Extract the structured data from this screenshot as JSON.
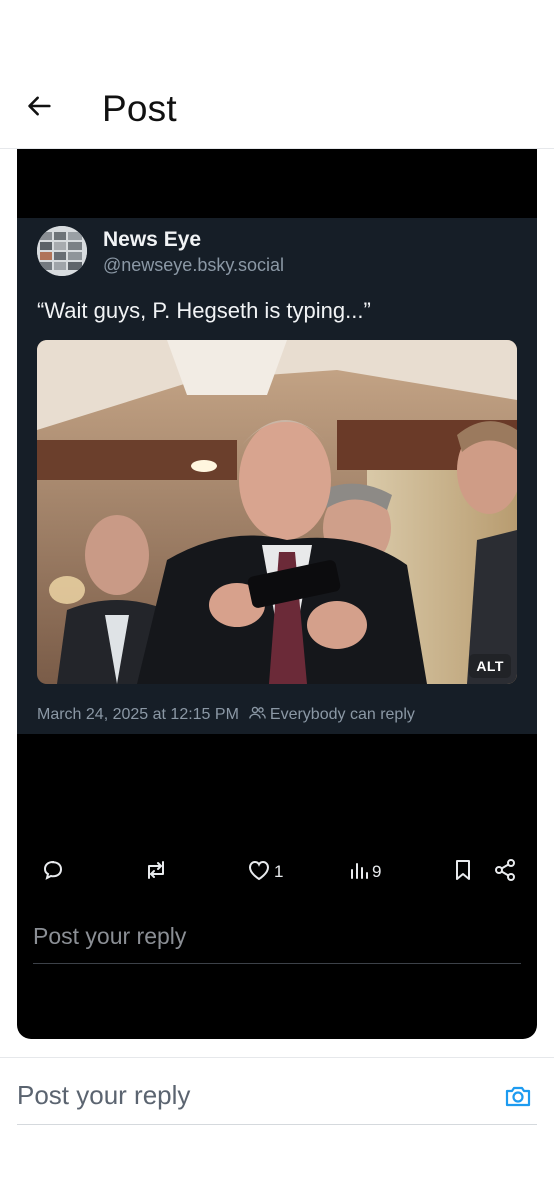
{
  "header": {
    "title": "Post",
    "back_icon": "arrow-left-icon"
  },
  "post": {
    "author_name": "News Eye",
    "author_handle": "@newseye.bsky.social",
    "text": "“Wait guys, P. Hegseth is typing...”",
    "image_alt_badge": "ALT",
    "timestamp": "March 24, 2025 at 12:15 PM",
    "reply_permission": "Everybody can reply"
  },
  "actions": {
    "reply_icon": "speech-bubble-icon",
    "repost_icon": "repost-icon",
    "like_icon": "heart-icon",
    "like_count": "1",
    "views_icon": "bar-chart-icon",
    "views_count": "9",
    "bookmark_icon": "bookmark-icon",
    "share_icon": "share-icon"
  },
  "inner_reply": {
    "placeholder": "Post your reply"
  },
  "bottom_reply": {
    "placeholder": "Post your reply",
    "camera_icon": "camera-icon"
  },
  "colors": {
    "accent": "#1d9bf0",
    "card_bg": "#000000",
    "embed_bg": "#161e27"
  }
}
